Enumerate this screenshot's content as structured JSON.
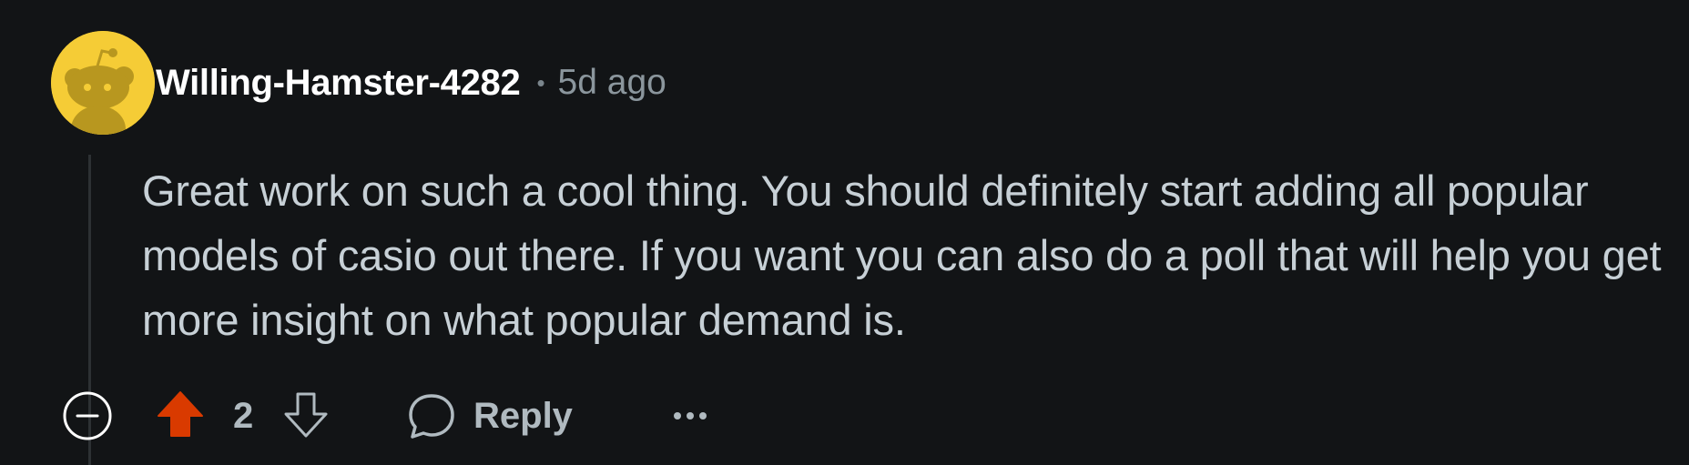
{
  "comment": {
    "author": "Willing-Hamster-4282",
    "separator": "•",
    "timestamp": "5d ago",
    "body": "Great work on such a cool thing. You should definitely start adding all popular models of casio out there. If you want you can also do a poll that will help you get more insight on what popular demand is.",
    "score": "2",
    "reply_label": "Reply",
    "vote_state": "upvoted"
  },
  "icons": {
    "avatar": "snoo-avatar",
    "collapse": "collapse-minus-icon",
    "upvote": "upvote-arrow-icon",
    "downvote": "downvote-arrow-icon",
    "reply": "speech-bubble-icon",
    "more": "ellipsis-icon"
  },
  "colors": {
    "background": "#121416",
    "upvote_active": "#d93a00",
    "avatar_bg": "#f5cc36",
    "text": "#c7d0d6",
    "meta": "#8b969d"
  }
}
